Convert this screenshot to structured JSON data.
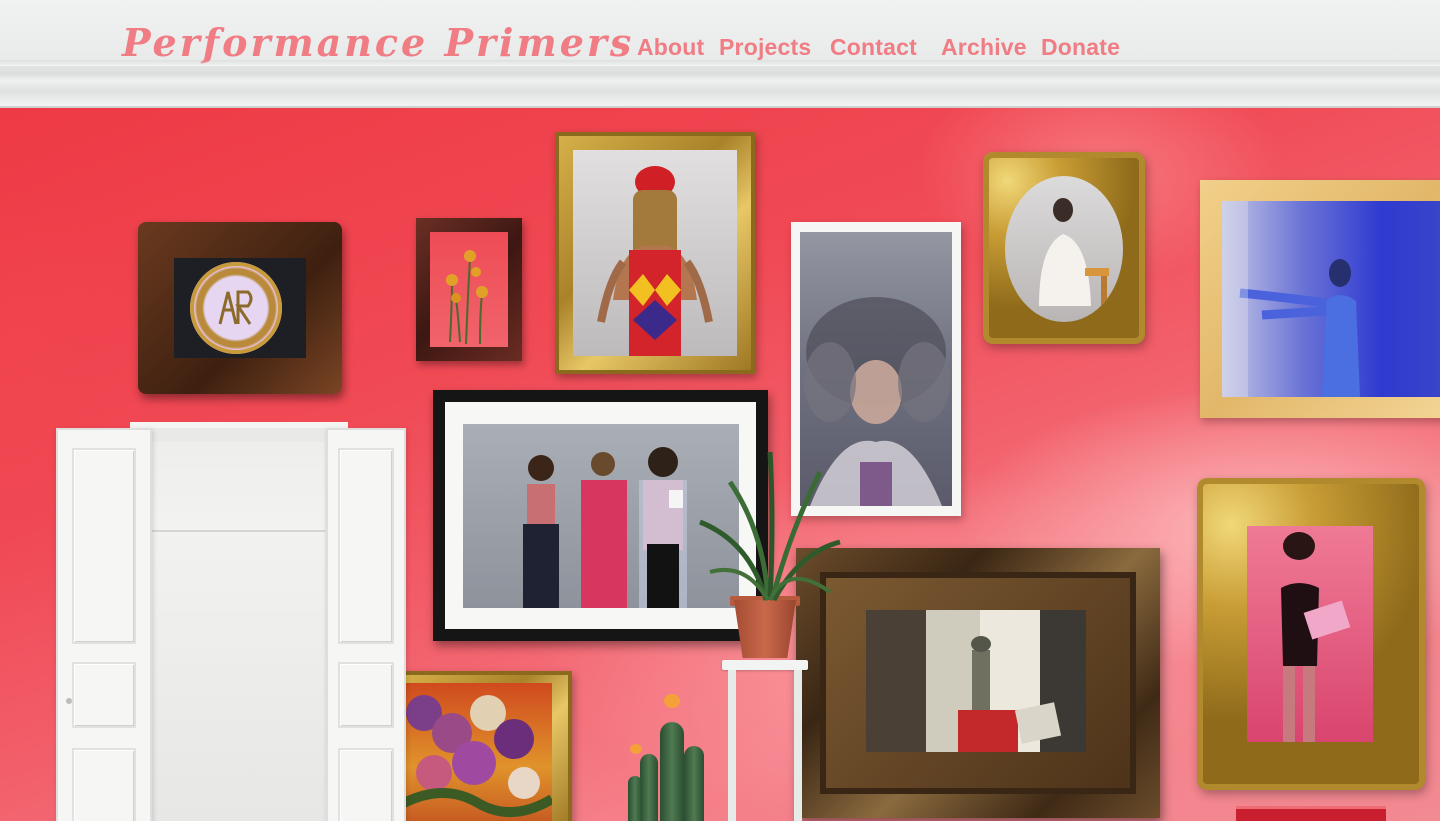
{
  "site": {
    "logo": "Performance Primers"
  },
  "nav": {
    "items": [
      {
        "label": "About",
        "name": "nav-about"
      },
      {
        "label": "Projects",
        "name": "nav-projects"
      },
      {
        "label": "Contact",
        "name": "nav-contact"
      },
      {
        "label": "Archive",
        "name": "nav-archive"
      },
      {
        "label": "Donate",
        "name": "nav-donate"
      }
    ]
  },
  "colors": {
    "accent": "#f07c84",
    "wall": "#ef4650",
    "header_bg": "#e9eaea"
  },
  "icons": {
    "logo_emblem": "pr-monogram-icon"
  }
}
